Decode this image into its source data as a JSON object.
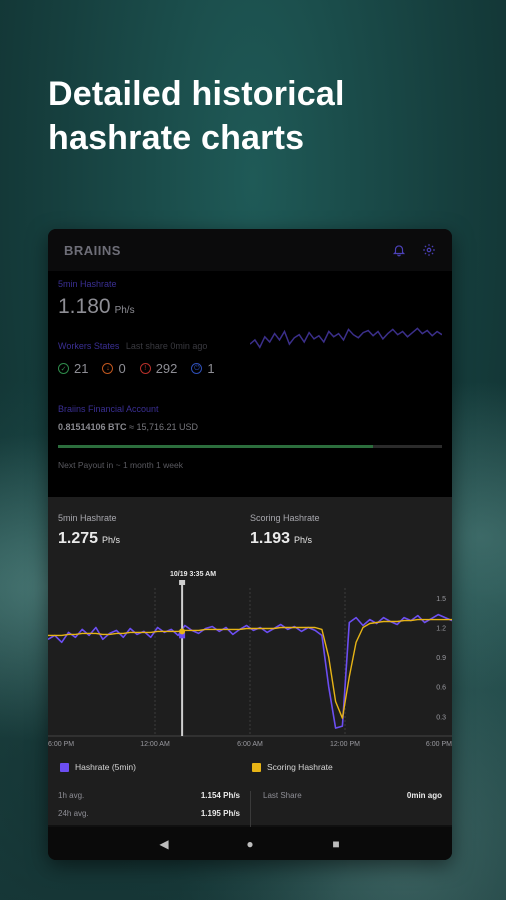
{
  "headline": "Detailed historical hashrate charts",
  "app": {
    "brand": "BRAIINS",
    "icons": [
      "bell-icon",
      "gear-icon"
    ]
  },
  "dashboard": {
    "hashrate_label": "5min Hashrate",
    "hashrate_value": "1.180",
    "hashrate_unit": "Ph/s",
    "workers_label": "Workers States",
    "last_share": "Last share 0min ago",
    "workers": [
      {
        "name": "ok",
        "count": "21",
        "color": "#2e8b4a",
        "icon": "check-icon"
      },
      {
        "name": "low",
        "count": "0",
        "color": "#c0561e",
        "icon": "arrow-down-icon"
      },
      {
        "name": "off",
        "count": "292",
        "color": "#b8302a",
        "icon": "alert-icon"
      },
      {
        "name": "dis",
        "count": "1",
        "color": "#2e4fb8",
        "icon": "power-icon"
      }
    ],
    "account_label": "Braiins Financial Account",
    "btc_value": "0.81514106 BTC",
    "usd_value": "≈ 15,716.21 USD",
    "payout_progress": 0.82,
    "payout_text": "Next Payout in ~ 1 month 1 week"
  },
  "stats": {
    "left_label": "5min Hashrate",
    "left_value": "1.275",
    "left_unit": "Ph/s",
    "right_label": "Scoring Hashrate",
    "right_value": "1.193",
    "right_unit": "Ph/s",
    "tooltip": "10/19 3:35 AM"
  },
  "chart_data": {
    "type": "line",
    "x_ticks": [
      "6:00 PM",
      "12:00 AM",
      "6:00 AM",
      "12:00 PM",
      "6:00 PM"
    ],
    "y_ticks": [
      "1.5",
      "1.2",
      "0.9",
      "0.6",
      "0.3"
    ],
    "ylim": [
      0.1,
      1.6
    ],
    "series": [
      {
        "name": "Hashrate (5min)",
        "color": "#6c4ef2",
        "values": [
          1.08,
          1.12,
          1.05,
          1.15,
          1.1,
          1.18,
          1.12,
          1.2,
          1.08,
          1.14,
          1.17,
          1.1,
          1.19,
          1.13,
          1.16,
          1.1,
          1.2,
          1.15,
          1.18,
          1.12,
          1.22,
          1.17,
          1.14,
          1.19,
          1.21,
          1.16,
          1.2,
          1.13,
          1.18,
          1.22,
          1.17,
          1.2,
          1.15,
          1.19,
          1.23,
          1.18,
          1.21,
          1.16,
          1.2,
          1.17,
          1.12,
          0.6,
          0.18,
          0.2,
          1.25,
          1.3,
          1.22,
          1.28,
          1.24,
          1.3,
          1.26,
          1.23,
          1.3,
          1.27,
          1.32,
          1.25,
          1.29,
          1.33,
          1.3,
          1.27
        ]
      },
      {
        "name": "Scoring Hashrate",
        "color": "#e7b416",
        "values": [
          1.12,
          1.12,
          1.12,
          1.13,
          1.13,
          1.14,
          1.14,
          1.14,
          1.13,
          1.13,
          1.14,
          1.14,
          1.15,
          1.15,
          1.15,
          1.15,
          1.16,
          1.16,
          1.16,
          1.16,
          1.17,
          1.17,
          1.17,
          1.18,
          1.18,
          1.18,
          1.18,
          1.18,
          1.18,
          1.19,
          1.19,
          1.19,
          1.19,
          1.19,
          1.2,
          1.2,
          1.2,
          1.2,
          1.2,
          1.2,
          1.18,
          0.9,
          0.45,
          0.28,
          0.7,
          1.05,
          1.2,
          1.24,
          1.25,
          1.26,
          1.26,
          1.26,
          1.27,
          1.27,
          1.28,
          1.28,
          1.28,
          1.28,
          1.28,
          1.28
        ]
      }
    ],
    "cursor_index": 19
  },
  "legend": {
    "hashrate_label": "Hashrate (5min)",
    "scoring_label": "Scoring Hashrate"
  },
  "averages": {
    "h1_label": "1h avg.",
    "h1_value": "1.154 Ph/s",
    "h24_label": "24h avg.",
    "h24_value": "1.195 Ph/s",
    "last_share_label": "Last Share",
    "last_share_value": "0min ago"
  },
  "nav": {
    "back": "◀",
    "home": "●",
    "recents": "■"
  }
}
